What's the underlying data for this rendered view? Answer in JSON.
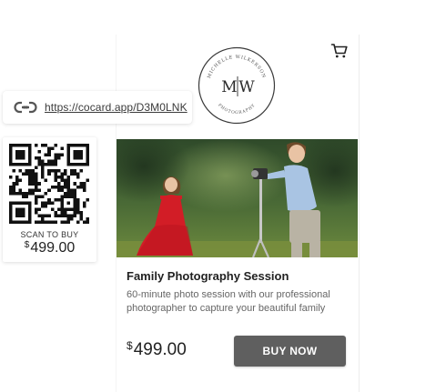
{
  "header": {
    "logo": {
      "arc_top": "MICHELLE WILKERSON",
      "arc_bottom": "PHOTOGRAPHY",
      "monogram_left": "M",
      "monogram_right": "W"
    },
    "cart_icon": "shopping-cart-icon"
  },
  "link": {
    "icon": "link-icon",
    "url_text": "https://cocard.app/D3M0LNK"
  },
  "qr": {
    "scan_label": "SCAN TO BUY",
    "currency": "$",
    "price": "499.00"
  },
  "product": {
    "title": "Family Photography Session",
    "description": "60-minute photo session with our professional photographer to capture your beautiful family",
    "currency": "$",
    "price": "499.00",
    "buy_label": "BUY NOW"
  },
  "colors": {
    "button_bg": "#5f5f5f",
    "button_text": "#ffffff",
    "text_primary": "#222222",
    "text_secondary": "#666666"
  }
}
